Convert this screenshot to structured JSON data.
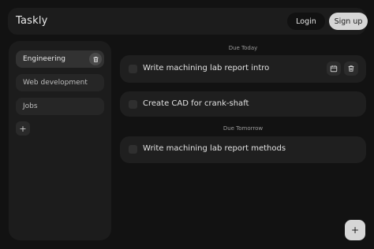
{
  "app": {
    "title": "Taskly"
  },
  "header": {
    "login_label": "Login",
    "signup_label": "Sign up"
  },
  "sidebar": {
    "items": [
      {
        "label": "Engineering",
        "active": true
      },
      {
        "label": "Web development",
        "active": false
      },
      {
        "label": "Jobs",
        "active": false
      }
    ],
    "add_label": "+"
  },
  "sections": [
    {
      "title": "Due Today",
      "tasks": [
        {
          "text": "Write machining lab report intro",
          "icons": [
            "calendar-icon",
            "trash-icon"
          ]
        },
        {
          "text": "Create CAD for crank-shaft",
          "icons": []
        }
      ]
    },
    {
      "title": "Due Tomorrow",
      "tasks": [
        {
          "text": "Write machining lab report methods",
          "icons": []
        }
      ]
    }
  ],
  "fab_label": "+",
  "colors": {
    "background": "#121212",
    "panel": "#1c1c1c",
    "task_card": "#1f1f1f",
    "accent_light": "#d6d6d6"
  }
}
